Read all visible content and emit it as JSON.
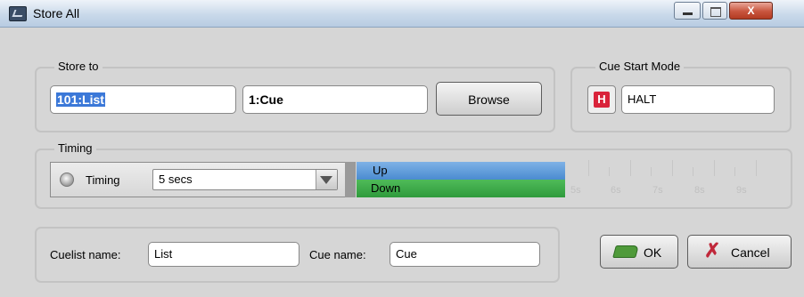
{
  "window": {
    "title": "Store All",
    "close_glyph": "X"
  },
  "store_to": {
    "legend": "Store to",
    "cuelist_value": "101:List",
    "cue_value": "1:Cue",
    "browse_label": "Browse"
  },
  "cue_start_mode": {
    "legend": "Cue Start Mode",
    "badge": "H",
    "value": "HALT",
    "badge_color": "#d9233a"
  },
  "timing": {
    "legend": "Timing",
    "label": "Timing",
    "select_value": "5 secs",
    "bars": {
      "up_label": "Up",
      "down_label": "Down",
      "up_color": "#4a8bd0",
      "down_color": "#2f9a3c"
    },
    "scale": [
      "5s",
      "6s",
      "7s",
      "8s",
      "9s"
    ]
  },
  "names": {
    "cuelist_label": "Cuelist name:",
    "cuelist_value": "List",
    "cue_label": "Cue name:",
    "cue_value": "Cue"
  },
  "buttons": {
    "ok_label": "OK",
    "cancel_label": "Cancel"
  },
  "icons": [
    "app-icon",
    "minimize-icon",
    "maximize-icon",
    "close-icon",
    "halt-badge-icon",
    "dropdown-arrow-icon",
    "ok-icon",
    "cancel-x-icon"
  ]
}
